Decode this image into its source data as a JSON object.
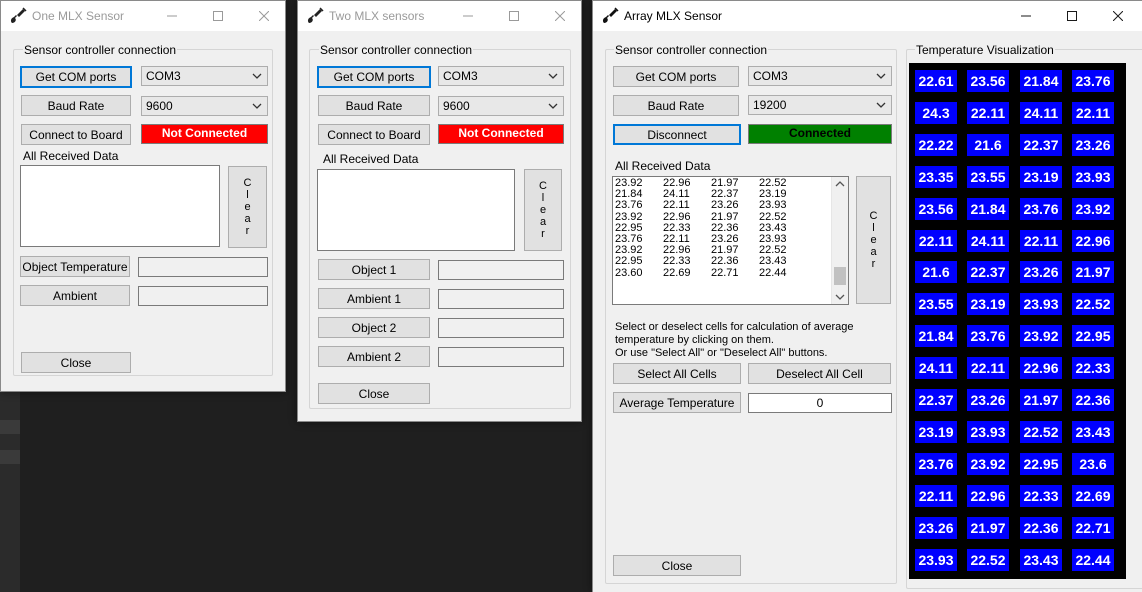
{
  "window1": {
    "title": "One MLX Sensor",
    "group_label": "Sensor controller connection",
    "get_com_ports": "Get COM ports",
    "com_port": "COM3",
    "baud_rate_label": "Baud Rate",
    "baud_rate": "9600",
    "connect_label": "Connect to Board",
    "status": "Not Connected",
    "received_label": "All Received Data",
    "clear_letters": [
      "C",
      "l",
      "e",
      "a",
      "r"
    ],
    "object_temp_label": "Object Temperature",
    "ambient_label": "Ambient",
    "close_label": "Close"
  },
  "window2": {
    "title": "Two MLX sensors",
    "group_label": "Sensor controller connection",
    "get_com_ports": "Get COM ports",
    "com_port": "COM3",
    "baud_rate_label": "Baud Rate",
    "baud_rate": "9600",
    "connect_label": "Connect to Board",
    "status": "Not Connected",
    "received_label": "All Received Data",
    "clear_letters": [
      "C",
      "l",
      "e",
      "a",
      "r"
    ],
    "object1_label": "Object 1",
    "ambient1_label": "Ambient 1",
    "object2_label": "Object 2",
    "ambient2_label": "Ambient 2",
    "close_label": "Close"
  },
  "window3": {
    "title": "Array MLX Sensor",
    "group_label": "Sensor controller connection",
    "get_com_ports": "Get COM ports",
    "com_port": "COM3",
    "baud_rate_label": "Baud Rate",
    "baud_rate": "19200",
    "disconnect_label": "Disconnect",
    "status": "Connected",
    "received_label": "All Received Data",
    "received_lines": [
      [
        "23.92",
        "22.96",
        "21.97",
        "22.52"
      ],
      [
        "21.84",
        "24.11",
        "22.37",
        "23.19"
      ],
      [
        "23.76",
        "22.11",
        "23.26",
        "23.93"
      ],
      [
        "23.92",
        "22.96",
        "21.97",
        "22.52"
      ],
      [
        "22.95",
        "22.33",
        "22.36",
        "23.43"
      ],
      [
        "23.76",
        "22.11",
        "23.26",
        "23.93"
      ],
      [
        "23.92",
        "22.96",
        "21.97",
        "22.52"
      ],
      [
        "22.95",
        "22.33",
        "22.36",
        "23.43"
      ],
      [
        "23.60",
        "22.69",
        "22.71",
        "22.44"
      ]
    ],
    "clear_letters": [
      "C",
      "l",
      "e",
      "a",
      "r"
    ],
    "instructions": [
      "Select or deselect cells for calculation of average",
      "temperature by clicking on them.",
      "Or use \"Select All\" or \"Deselect All\" buttons."
    ],
    "select_all_label": "Select All Cells",
    "deselect_all_label": "Deselect All Cell",
    "average_label": "Average Temperature",
    "average_value": "0",
    "close_label": "Close",
    "viz_label": "Temperature Visualization",
    "grid": [
      [
        "22.61",
        "23.56",
        "21.84",
        "23.76"
      ],
      [
        "24.3",
        "22.11",
        "24.11",
        "22.11"
      ],
      [
        "22.22",
        "21.6",
        "22.37",
        "23.26"
      ],
      [
        "23.35",
        "23.55",
        "23.19",
        "23.93"
      ],
      [
        "23.56",
        "21.84",
        "23.76",
        "23.92"
      ],
      [
        "22.11",
        "24.11",
        "22.11",
        "22.96"
      ],
      [
        "21.6",
        "22.37",
        "23.26",
        "21.97"
      ],
      [
        "23.55",
        "23.19",
        "23.93",
        "22.52"
      ],
      [
        "21.84",
        "23.76",
        "23.92",
        "22.95"
      ],
      [
        "24.11",
        "22.11",
        "22.96",
        "22.33"
      ],
      [
        "22.37",
        "23.26",
        "21.97",
        "22.36"
      ],
      [
        "23.19",
        "23.93",
        "22.52",
        "23.43"
      ],
      [
        "23.76",
        "23.92",
        "22.95",
        "23.6"
      ],
      [
        "22.11",
        "22.96",
        "22.33",
        "22.69"
      ],
      [
        "23.26",
        "21.97",
        "22.36",
        "22.71"
      ],
      [
        "23.93",
        "22.52",
        "23.43",
        "22.44"
      ]
    ]
  },
  "colors": {
    "not_connected": "#ff0000",
    "connected": "#008000",
    "cell_bg": "#0000ff",
    "cell_text": "#ffffff",
    "viz_bg": "#000000",
    "focus_border": "#0078d7"
  },
  "icons": {
    "app": "guitar-app-icon",
    "minimize": "minimize-icon",
    "maximize": "maximize-icon",
    "close": "close-icon",
    "dropdown": "chevron-down-icon"
  }
}
